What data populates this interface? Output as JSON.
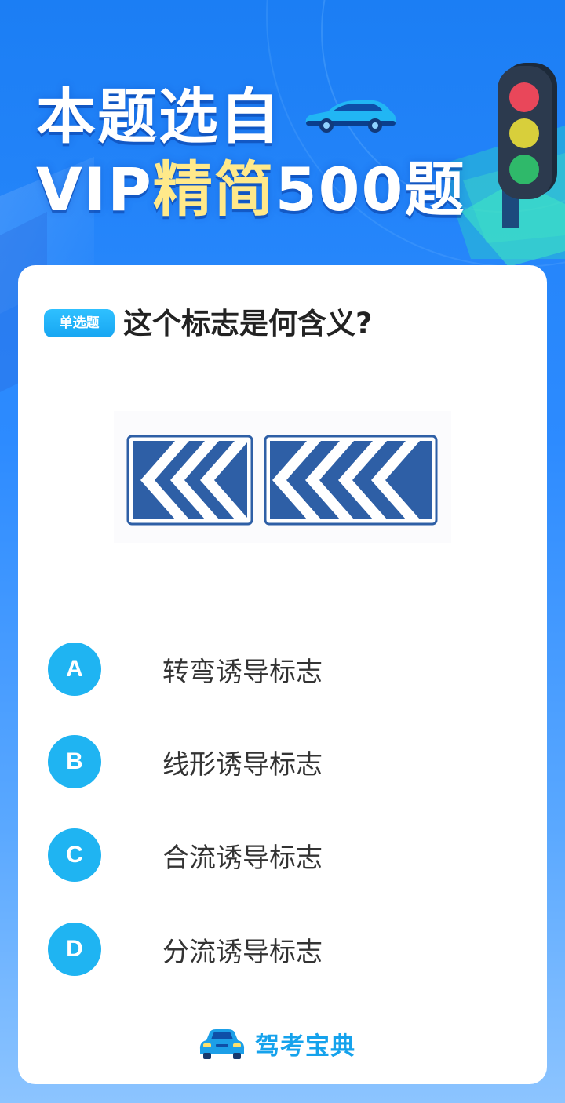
{
  "header": {
    "line1": "本题选自",
    "line2_prefix": "VIP",
    "line2_accent": "精简",
    "line2_suffix": "500题"
  },
  "question": {
    "type_badge": "单选题",
    "title": "这个标志是何含义?"
  },
  "options": [
    {
      "letter": "A",
      "text": "转弯诱导标志"
    },
    {
      "letter": "B",
      "text": "线形诱导标志"
    },
    {
      "letter": "C",
      "text": "合流诱导标志"
    },
    {
      "letter": "D",
      "text": "分流诱导标志"
    }
  ],
  "brand": {
    "name": "驾考宝典"
  },
  "colors": {
    "background_top": "#1b7ef4",
    "accent_text": "#ffe98a",
    "option_circle": "#1fb4f2",
    "sign_blue": "#2e5fa6"
  },
  "icons": {
    "hero_car": "car-icon",
    "traffic_light": "traffic-light-icon",
    "brand_logo": "car-logo-icon",
    "sign": "line-guidance-sign-image"
  }
}
